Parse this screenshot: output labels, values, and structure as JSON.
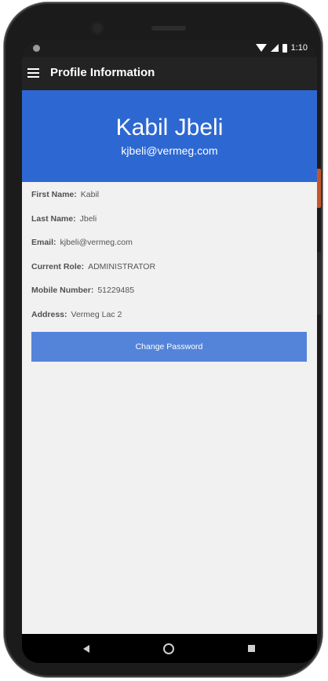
{
  "status_bar": {
    "time": "1:10",
    "icons": [
      "wifi-icon",
      "signal-icon",
      "battery-icon"
    ]
  },
  "app_bar": {
    "menu_icon": "menu-icon",
    "title": "Profile Information"
  },
  "profile": {
    "name": "Kabil Jbeli",
    "email": "kjbeli@vermeg.com"
  },
  "fields": [
    {
      "label": "First Name:",
      "value": "Kabil"
    },
    {
      "label": "Last Name:",
      "value": "Jbeli"
    },
    {
      "label": "Email:",
      "value": "kjbeli@vermeg.com"
    },
    {
      "label": "Current Role:",
      "value": "ADMINISTRATOR"
    },
    {
      "label": "Mobile Number:",
      "value": "51229485"
    },
    {
      "label": "Address:",
      "value": "Vermeg Lac 2"
    }
  ],
  "actions": {
    "change_password_label": "Change Password"
  },
  "nav_bar": {
    "icons": [
      "back-icon",
      "home-icon",
      "recents-icon"
    ]
  },
  "colors": {
    "header_blue": "#2d68d2",
    "button_blue": "#5484d9",
    "app_bar_dark": "#232323",
    "background": "#f1f1f1"
  }
}
